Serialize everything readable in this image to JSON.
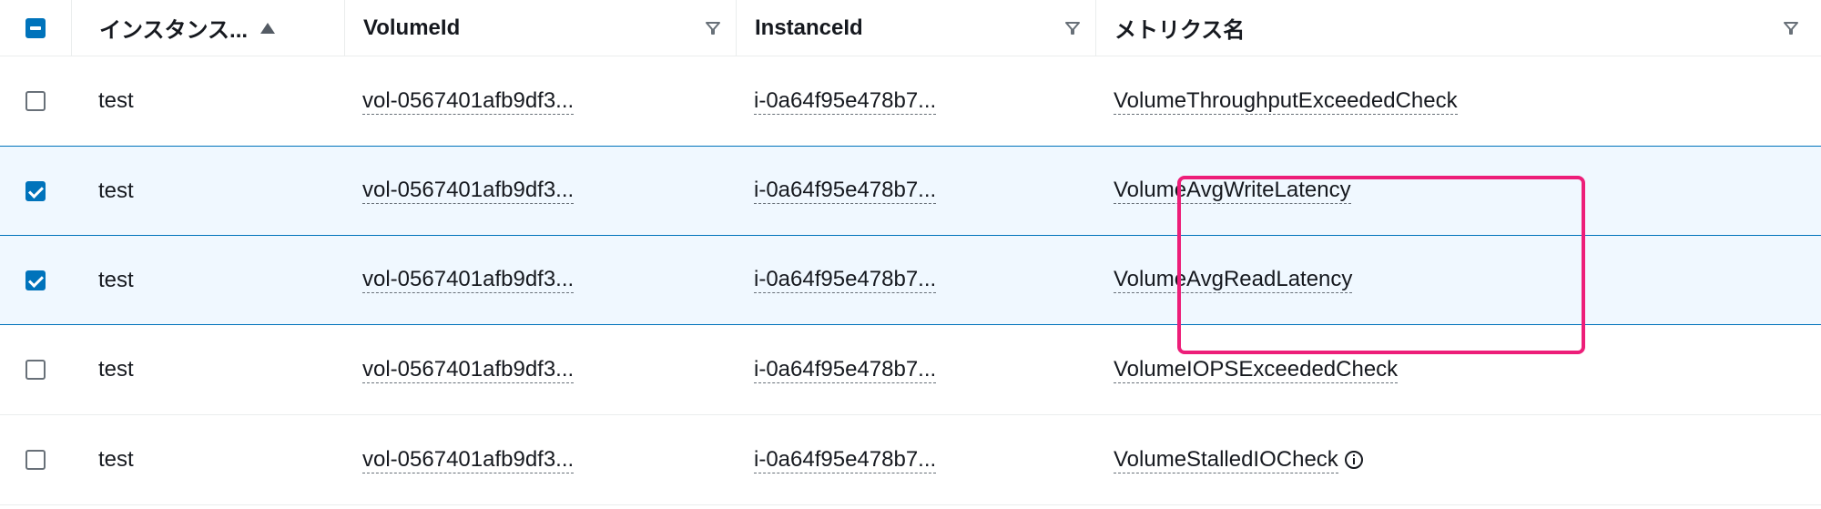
{
  "columns": {
    "instance_name": "インスタンス...",
    "volume_id": "VolumeId",
    "instance_id": "InstanceId",
    "metric_name": "メトリクス名"
  },
  "rows": [
    {
      "checked": false,
      "instance_name": "test",
      "volume_id": "vol-0567401afb9df3...",
      "instance_id": "i-0a64f95e478b7...",
      "metric_name": "VolumeThroughputExceededCheck",
      "info_icon": false
    },
    {
      "checked": true,
      "instance_name": "test",
      "volume_id": "vol-0567401afb9df3...",
      "instance_id": "i-0a64f95e478b7...",
      "metric_name": "VolumeAvgWriteLatency",
      "info_icon": false
    },
    {
      "checked": true,
      "instance_name": "test",
      "volume_id": "vol-0567401afb9df3...",
      "instance_id": "i-0a64f95e478b7...",
      "metric_name": "VolumeAvgReadLatency",
      "info_icon": false
    },
    {
      "checked": false,
      "instance_name": "test",
      "volume_id": "vol-0567401afb9df3...",
      "instance_id": "i-0a64f95e478b7...",
      "metric_name": "VolumeIOPSExceededCheck",
      "info_icon": false
    },
    {
      "checked": false,
      "instance_name": "test",
      "volume_id": "vol-0567401afb9df3...",
      "instance_id": "i-0a64f95e478b7...",
      "metric_name": "VolumeStalledIOCheck",
      "info_icon": true
    }
  ],
  "header_checkbox_state": "indeterminate"
}
